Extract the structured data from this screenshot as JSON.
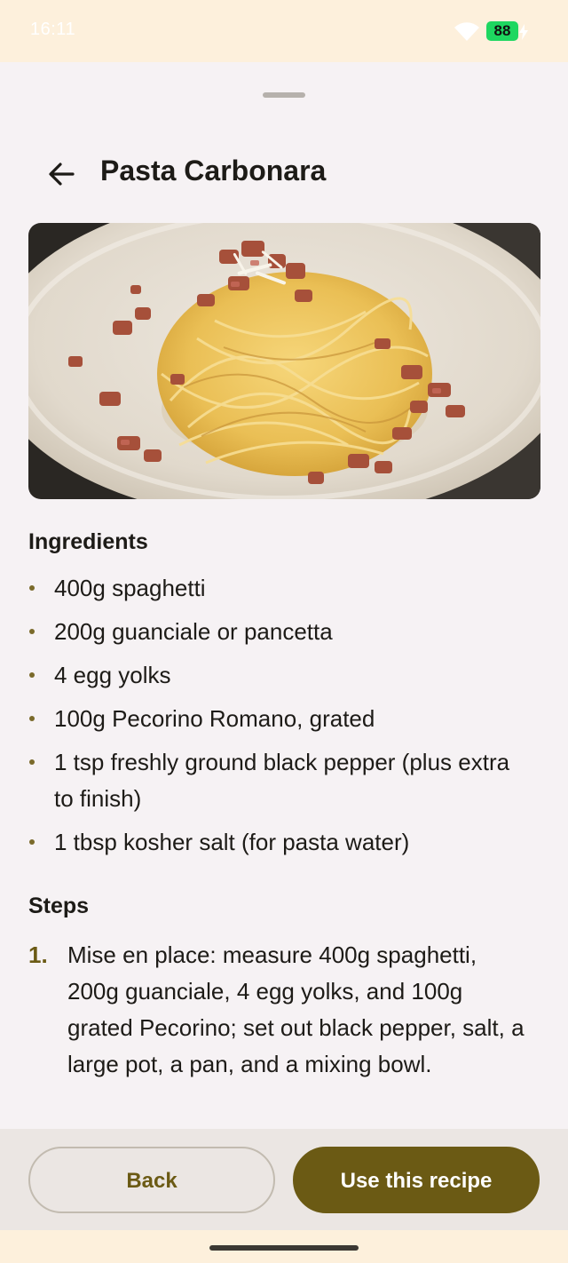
{
  "status_bar": {
    "time": "16:11",
    "battery": "88"
  },
  "header": {
    "title": "Pasta Carbonara"
  },
  "hero_image": {
    "alt": "Pasta Carbonara"
  },
  "ingredients": {
    "heading": "Ingredients",
    "items": [
      "400g spaghetti",
      "200g guanciale or pancetta",
      "4 egg yolks",
      "100g Pecorino Romano, grated",
      "1 tsp freshly ground black pepper (plus extra to finish)",
      "1 tbsp kosher salt (for pasta water)"
    ]
  },
  "steps": {
    "heading": "Steps",
    "items": [
      {
        "number": "1.",
        "text": "Mise en place: measure 400g spaghetti, 200g guanciale, 4 egg yolks, and 100g grated Pecorino; set out black pepper, salt, a large pot, a pan, and a mixing bowl."
      }
    ]
  },
  "actions": {
    "back_label": "Back",
    "use_label": "Use this recipe"
  },
  "colors": {
    "accent": "#6b5a14",
    "sheet_background": "#f6f2f4",
    "system_bar": "#fdf0dc",
    "battery": "#1ed760"
  }
}
